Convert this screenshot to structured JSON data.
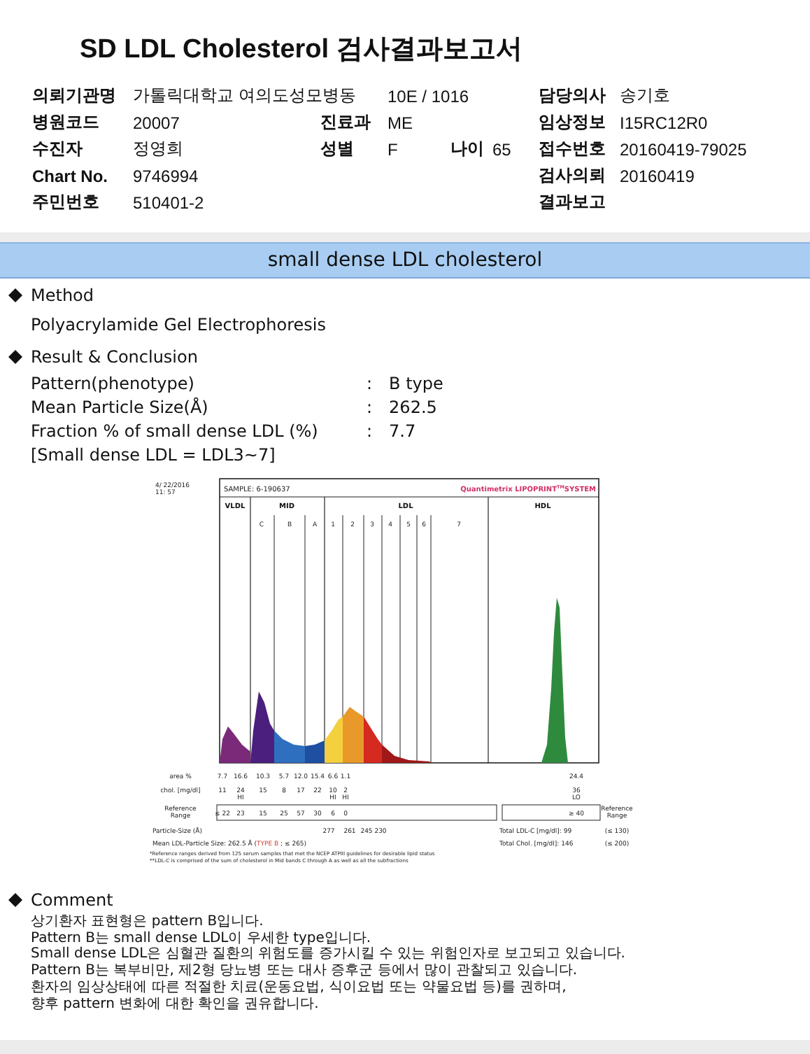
{
  "report_title": "SD LDL Cholesterol 검사결과보고서",
  "header_rows": [
    {
      "col1": {
        "label": "의뢰기관명",
        "value": "가톨릭대학교 여의도성모병동"
      },
      "col2": {
        "value": "10E / 1016"
      },
      "col4": {
        "label": "담당의사",
        "value": "송기호"
      }
    },
    {
      "col1": {
        "label": "병원코드",
        "value": "20007"
      },
      "col2": {
        "label": "진료과",
        "value": "ME"
      },
      "col4": {
        "label": "임상정보",
        "value": "I15RC12R0"
      }
    },
    {
      "col1": {
        "label": "수진자",
        "value": "정영희"
      },
      "col2": {
        "label": "성별",
        "value": "F"
      },
      "col3": {
        "label": "나이",
        "value": "65"
      },
      "col4": {
        "label": "접수번호",
        "value": "20160419-79025"
      }
    },
    {
      "col1": {
        "label": "Chart No.",
        "value": "9746994"
      },
      "col4": {
        "label": "검사의뢰",
        "value": "20160419"
      }
    },
    {
      "col1": {
        "label": "주민번호",
        "value": "510401-2"
      },
      "col4": {
        "label": "결과보고"
      }
    }
  ],
  "section_banner": "small dense LDL cholesterol",
  "method": {
    "title": "Method",
    "text": "Polyacrylamide Gel Electrophoresis"
  },
  "result": {
    "title": "Result & Conclusion",
    "rows": [
      {
        "label": "Pattern(phenotype)",
        "value": "B type"
      },
      {
        "label": "Mean Particle Size(Å)",
        "value": "262.5"
      },
      {
        "label": "Fraction % of small dense LDL (%)",
        "value": "7.7"
      }
    ],
    "separator": ":",
    "note": "[Small dense LDL = LDL3~7]"
  },
  "lipoprint": {
    "timestamp": [
      "4/ 22/2016",
      "11: 57"
    ],
    "sample": "SAMPLE:  6-190637",
    "brand": {
      "text": "Quantimetrix LIPOPRINT",
      "sup": "TM",
      "tail": "SYSTEM"
    },
    "groups": [
      "VLDL",
      "MID",
      "LDL",
      "HDL"
    ],
    "bands": [
      "C",
      "B",
      "A",
      "1",
      "2",
      "3",
      "4",
      "5",
      "6",
      "7"
    ],
    "area_label": "area %",
    "area": [
      "7.7",
      "16.6",
      "10.3",
      "5.7",
      "12.0",
      "15.4",
      "6.6",
      "1.1"
    ],
    "hdl_area": "24.4",
    "chol_label": "chol. [mg/dl]",
    "chol": [
      {
        "value": "11"
      },
      {
        "value": "24",
        "flag": "HI"
      },
      {
        "value": "15"
      },
      {
        "value": "8"
      },
      {
        "value": "17"
      },
      {
        "value": "22"
      },
      {
        "value": "10",
        "flag": "HI"
      },
      {
        "value": "2",
        "flag": "HI"
      }
    ],
    "hdl_chol": {
      "value": "36",
      "flag": "LO"
    },
    "reference_label": [
      "Reference",
      "Range"
    ],
    "reference": [
      "≤ 22",
      "23",
      "15",
      "25",
      "57",
      "30",
      "6",
      "0"
    ],
    "hdl_reference": "≥ 40",
    "reference_label_right": [
      "Reference",
      "Range"
    ],
    "particle_label": "Particle-Size (Å)",
    "particle_sizes": [
      "277",
      "261",
      "245",
      "230"
    ],
    "total_ldl": {
      "label": "Total LDL-C [mg/dl]:  99",
      "limit": "(≤ 130)"
    },
    "total_chol": {
      "label": "Total Chol. [mg/dl]:  146",
      "limit": "(≤ 200)"
    },
    "mean_size": {
      "prefix": "Mean LDL-Particle Size:   262.5 Å  (",
      "highlight": "TYPE B",
      "suffix": " ; ≤ 265)"
    },
    "footnotes": [
      "*Reference ranges derived from 125 serum samples that met the NCEP ATPIII guidelines for desirable lipid status",
      "**LDL-C is comprised of the sum of cholesterol in Mid bands C through A as well as all the subfractions"
    ]
  },
  "comment": {
    "title": "Comment",
    "lines": [
      "상기환자 표현형은 pattern B입니다.",
      "Pattern B는 small dense LDL이 우세한 type입니다.",
      "Small dense LDL은 심혈관 질환의 위험도를 증가시킬 수 있는 위험인자로 보고되고 있습니다.",
      "Pattern B는 복부비만, 제2형 당뇨병 또는 대사 증후군 등에서 많이 관찰되고 있습니다.",
      "환자의 임상상태에 따른 적절한 치료(운동요법, 식이요법 또는 약물요법 등)를 권하며,",
      "향후 pattern 변화에 대한 확인을 권유합니다."
    ]
  }
}
